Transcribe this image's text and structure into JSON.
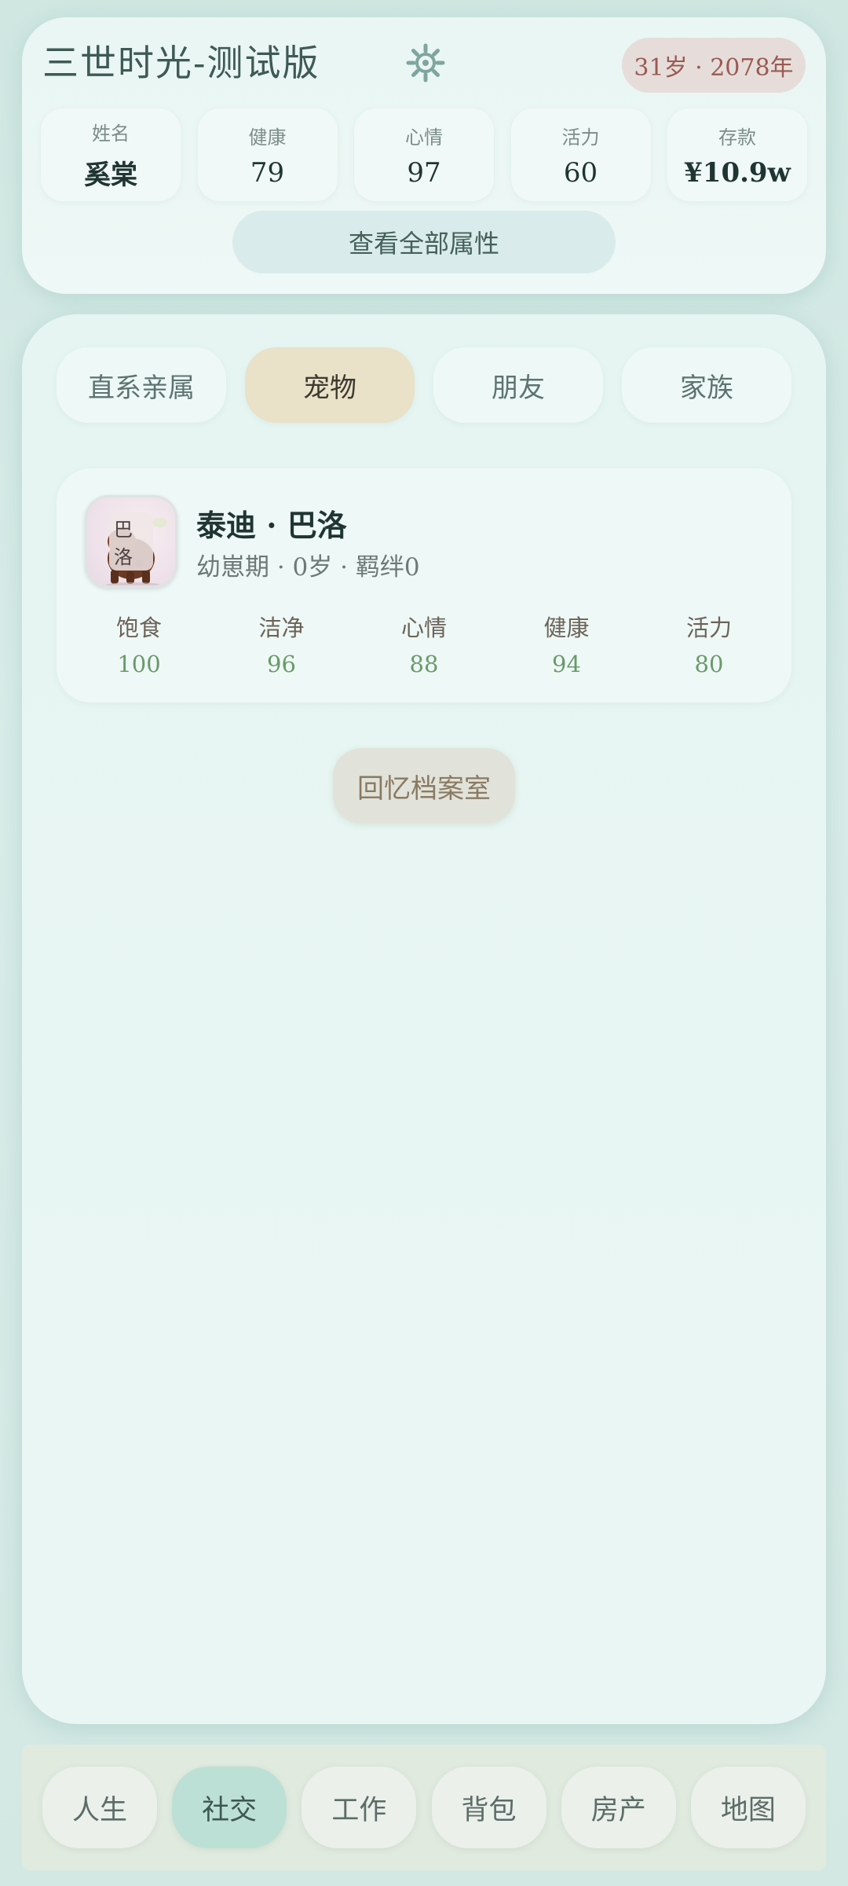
{
  "header": {
    "app_title": "三世时光-测试版",
    "age_badge": "31岁 · 2078年",
    "stats": [
      {
        "label": "姓名",
        "value": "奚棠"
      },
      {
        "label": "健康",
        "value": "79"
      },
      {
        "label": "心情",
        "value": "97"
      },
      {
        "label": "活力",
        "value": "60"
      },
      {
        "label": "存款",
        "value": "¥10.9w"
      }
    ],
    "view_all_label": "查看全部属性"
  },
  "tabs": [
    {
      "label": "直系亲属",
      "active": false
    },
    {
      "label": "宠物",
      "active": true
    },
    {
      "label": "朋友",
      "active": false
    },
    {
      "label": "家族",
      "active": false
    }
  ],
  "pet": {
    "avatar_tag": "巴洛",
    "name": "泰迪 · 巴洛",
    "meta": "幼崽期 · 0岁 · 羁绊0",
    "stats": [
      {
        "label": "饱食",
        "value": "100"
      },
      {
        "label": "洁净",
        "value": "96"
      },
      {
        "label": "心情",
        "value": "88"
      },
      {
        "label": "健康",
        "value": "94"
      },
      {
        "label": "活力",
        "value": "80"
      }
    ]
  },
  "memory_button_label": "回忆档案室",
  "bottom_nav": [
    {
      "label": "人生",
      "active": false
    },
    {
      "label": "社交",
      "active": true
    },
    {
      "label": "工作",
      "active": false
    },
    {
      "label": "背包",
      "active": false
    },
    {
      "label": "房产",
      "active": false
    },
    {
      "label": "地图",
      "active": false
    }
  ],
  "icons": {
    "settings": "gear-icon"
  },
  "colors": {
    "accent_active_tab": "#e9e1c8",
    "accent_active_nav": "#bde0d6",
    "age_badge_text": "#9a5a52",
    "pet_stat_value": "#6a9a6a"
  }
}
